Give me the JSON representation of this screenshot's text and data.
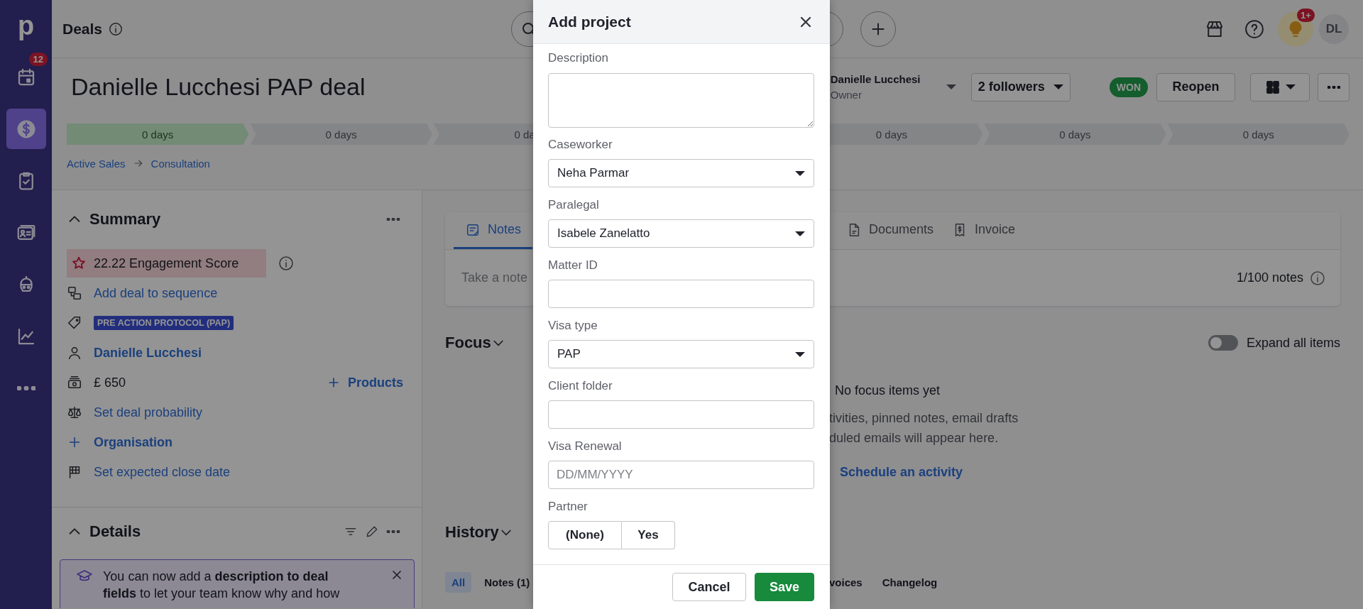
{
  "sidebar": {
    "logo": "p",
    "items": [
      {
        "selected": false,
        "badge": "12"
      },
      {
        "selected": true
      },
      {
        "selected": false
      },
      {
        "selected": false
      },
      {
        "selected": false
      },
      {
        "selected": false
      },
      {
        "selected": false
      }
    ]
  },
  "topbar": {
    "title": "Deals",
    "tips_badge": "1+",
    "avatar": "DL"
  },
  "deal": {
    "title": "Danielle Lucchesi PAP deal",
    "owner_name": "Danielle Lucchesi",
    "owner_role": "Owner",
    "followers": "2 followers",
    "status": "WON",
    "reopen": "Reopen"
  },
  "stages": [
    {
      "label": "0 days",
      "done": true
    },
    {
      "label": "0 days",
      "done": false
    },
    {
      "label": "0 da",
      "done": false
    },
    {
      "label": "0 days",
      "done": false
    },
    {
      "label": "0 days",
      "done": false
    },
    {
      "label": "0 days",
      "done": false
    }
  ],
  "breadcrumb": [
    "Active Sales",
    "Consultation"
  ],
  "summary": {
    "title": "Summary",
    "engagement": "22.22 Engagement Score",
    "items": [
      {
        "kind": "link",
        "text": "Add deal to sequence"
      },
      {
        "kind": "tag",
        "text": "PRE ACTION PROTOCOL (PAP)"
      },
      {
        "kind": "person",
        "text": "Danielle Lucchesi"
      },
      {
        "kind": "value",
        "text": "£ 650",
        "action": "Products"
      },
      {
        "kind": "link",
        "text": "Set deal probability"
      },
      {
        "kind": "add",
        "text": "Organisation"
      },
      {
        "kind": "link",
        "text": "Set expected close date"
      }
    ]
  },
  "details": {
    "title": "Details",
    "banner": "You can now add a **description to deal fields** to let your team know why and how"
  },
  "tabs": [
    {
      "label": "Notes",
      "selected": true
    },
    {
      "label": "Documents",
      "selected": false
    },
    {
      "label": "Invoice",
      "selected": false
    }
  ],
  "note": {
    "placeholder": "Take a note",
    "count": "1/100 notes"
  },
  "focus": {
    "title": "Focus",
    "expand_label": "Expand all items",
    "expand_on": false,
    "empty_title": "No focus items yet",
    "empty_lines": [
      "tivities, pinned notes, email drafts",
      "duled emails will appear here."
    ],
    "action": "Schedule an activity"
  },
  "history": {
    "title": "History",
    "filters": [
      {
        "label": "All",
        "selected": true
      },
      {
        "label": "Notes (1)",
        "selected": false
      },
      {
        "label": "voices",
        "selected": false
      },
      {
        "label": "Changelog",
        "selected": false
      }
    ]
  },
  "dialog": {
    "title": "Add project",
    "fields": [
      {
        "kind": "textarea",
        "label": "Description"
      },
      {
        "kind": "select",
        "label": "Caseworker",
        "value": "Neha Parmar"
      },
      {
        "kind": "select",
        "label": "Paralegal",
        "value": "Isabele Zanelatto"
      },
      {
        "kind": "input",
        "label": "Matter ID"
      },
      {
        "kind": "select",
        "label": "Visa type",
        "value": "PAP"
      },
      {
        "kind": "input",
        "label": "Client folder"
      },
      {
        "kind": "input",
        "label": "Visa Renewal",
        "placeholder": "DD/MM/YYYY"
      },
      {
        "kind": "choice",
        "label": "Partner",
        "options": [
          {
            "label": "(None)",
            "selected": false
          },
          {
            "label": "Yes",
            "selected": false
          }
        ]
      }
    ],
    "cancel": "Cancel",
    "save": "Save"
  }
}
